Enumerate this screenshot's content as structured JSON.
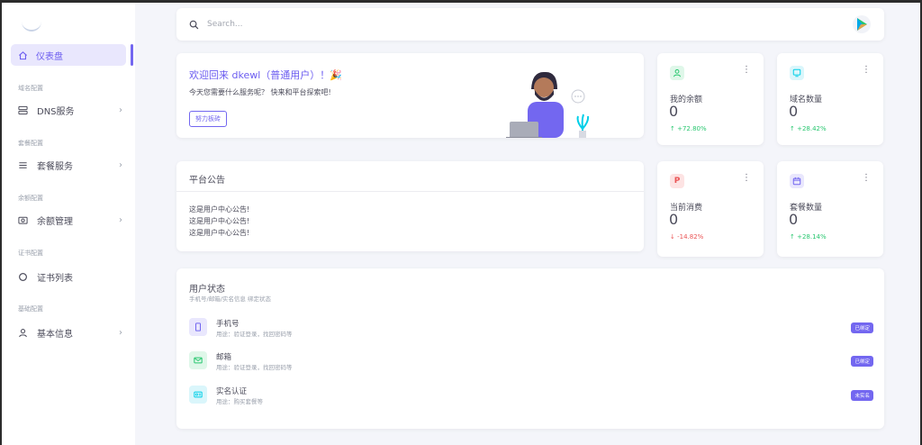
{
  "sidebar": {
    "items": [
      {
        "label": "仪表盘",
        "icon": "home-icon"
      },
      {
        "section": "域名配置",
        "label": "DNS服务",
        "icon": "server-icon"
      },
      {
        "section": "套餐配置",
        "label": "套餐服务",
        "icon": "list-icon"
      },
      {
        "section": "余额配置",
        "label": "余额管理",
        "icon": "camera-icon"
      },
      {
        "section": "证书配置",
        "label": "证书列表",
        "icon": "circle-icon"
      },
      {
        "section": "基础配置",
        "label": "基本信息",
        "icon": "user-icon"
      }
    ]
  },
  "search": {
    "placeholder": "Search..."
  },
  "welcome": {
    "title": "欢迎回来 dkewl（普通用户）！🎉",
    "subtitle": "今天您需要什么服务呢？ 快来和平台探索吧!",
    "button": "努力板砖"
  },
  "stats": [
    {
      "label": "我的余额",
      "value": "0",
      "change": "+72.80%",
      "direction": "up",
      "icon": "user-icon",
      "color": "#28c76f"
    },
    {
      "label": "域名数量",
      "value": "0",
      "change": "+28.42%",
      "direction": "up",
      "icon": "monitor-icon",
      "color": "#00cfe8"
    },
    {
      "label": "当前消费",
      "value": "0",
      "change": "-14.82%",
      "direction": "down",
      "icon": "paypal-icon",
      "color": "#ea5455"
    },
    {
      "label": "套餐数量",
      "value": "0",
      "change": "+28.14%",
      "direction": "up",
      "icon": "calendar-icon",
      "color": "#7367f0"
    }
  ],
  "notice": {
    "title": "平台公告",
    "lines": [
      "这是用户中心公告!",
      "这是用户中心公告!",
      "这是用户中心公告!"
    ]
  },
  "user_status": {
    "title": "用户状态",
    "subtitle": "手机号/邮箱/实名信息 绑定状态",
    "rows": [
      {
        "title": "手机号",
        "desc": "用途：验证登录，找回密码等",
        "badge": "已绑定",
        "icon": "phone-icon",
        "color": "#7367f0"
      },
      {
        "title": "邮箱",
        "desc": "用途：验证登录，找回密码等",
        "badge": "已绑定",
        "icon": "mail-icon",
        "color": "#28c76f"
      },
      {
        "title": "实名认证",
        "desc": "用途：购买套餐等",
        "badge": "未实名",
        "icon": "id-card-icon",
        "color": "#00cfe8"
      }
    ]
  }
}
